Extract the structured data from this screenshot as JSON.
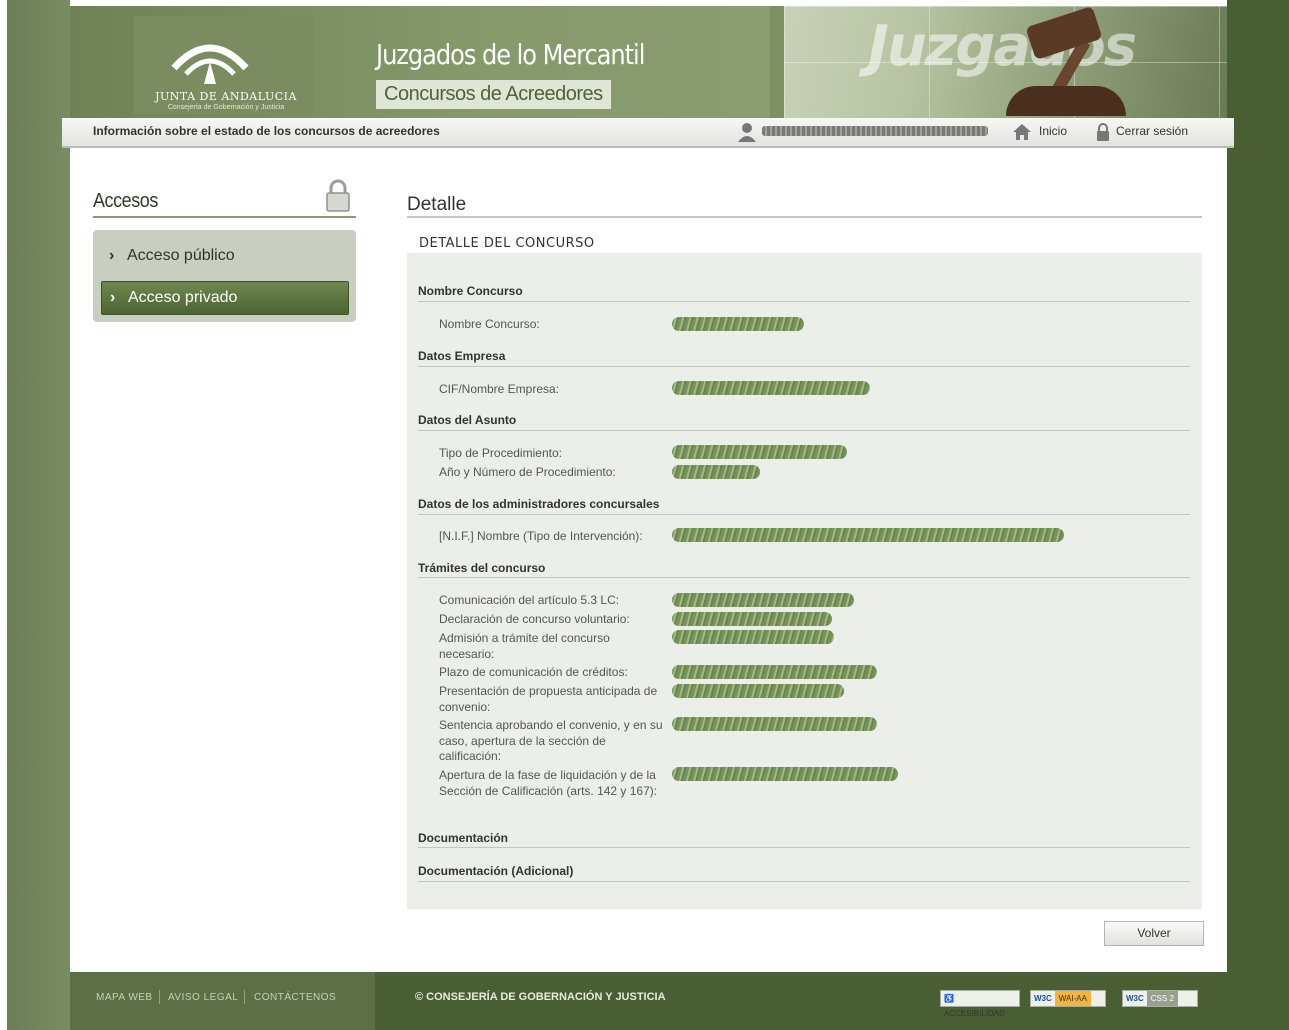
{
  "header": {
    "logo_text": "JUNTA DE ANDALUCIA",
    "logo_sub": "Consejería de Gobernación y Justicia",
    "site_title": "Juzgados de lo Mercantil",
    "site_subtitle": "Concursos de Acreedores",
    "banner_word": "Juzgados"
  },
  "infobar": {
    "text": "Información sobre el estado de los concursos de acreedores",
    "inicio": "Inicio",
    "cerrar_sesion": "Cerrar sesión"
  },
  "sidebar": {
    "title": "Accesos",
    "items": [
      {
        "label": "Acceso público",
        "active": false
      },
      {
        "label": "Acceso privado",
        "active": true
      }
    ]
  },
  "main": {
    "title": "Detalle",
    "subtitle": "DETALLE DEL CONCURSO",
    "sections": [
      {
        "heading": "Nombre Concurso",
        "fields": [
          {
            "label": "Nombre Concurso:"
          }
        ]
      },
      {
        "heading": "Datos Empresa",
        "fields": [
          {
            "label": "CIF/Nombre Empresa:"
          }
        ]
      },
      {
        "heading": "Datos del Asunto",
        "fields": [
          {
            "label": "Tipo de Procedimiento:"
          },
          {
            "label": "Año y Número de Procedimiento:"
          }
        ]
      },
      {
        "heading": "Datos de los administradores concursales",
        "fields": [
          {
            "label": "[N.I.F.] Nombre (Tipo de Intervención):"
          }
        ]
      },
      {
        "heading": "Trámites del concurso",
        "fields": [
          {
            "label": "Comunicación del artículo 5.3 LC:"
          },
          {
            "label": "Declaración de concurso voluntario:"
          },
          {
            "label": "Admisión a trámite del concurso necesario:"
          },
          {
            "label": "Plazo de comunicación de créditos:"
          },
          {
            "label": "Presentación de propuesta anticipada de convenio:"
          },
          {
            "label": "Sentencia aprobando el convenio, y en su caso, apertura de la sección de calificación:"
          },
          {
            "label": "Apertura de la fase de liquidación y de la Sección de Calificación (arts. 142 y 167):"
          }
        ]
      },
      {
        "heading": "Documentación",
        "fields": []
      },
      {
        "heading": "Documentación (Adicional)",
        "fields": []
      }
    ],
    "volver": "Volver"
  },
  "footer": {
    "links": [
      "MAPA WEB",
      "AVISO LEGAL",
      "CONTÁCTENOS"
    ],
    "copyright": "© CONSEJERÍA DE GOBERNACIÓN Y JUSTICIA",
    "badges": [
      "ACCESIBILIDAD",
      "W3C",
      "WAI-AA",
      "W3C",
      "CSS 2"
    ]
  },
  "colors": {
    "brand": "#4a5e34",
    "accent": "#6f8750",
    "panel": "#eceeea"
  }
}
